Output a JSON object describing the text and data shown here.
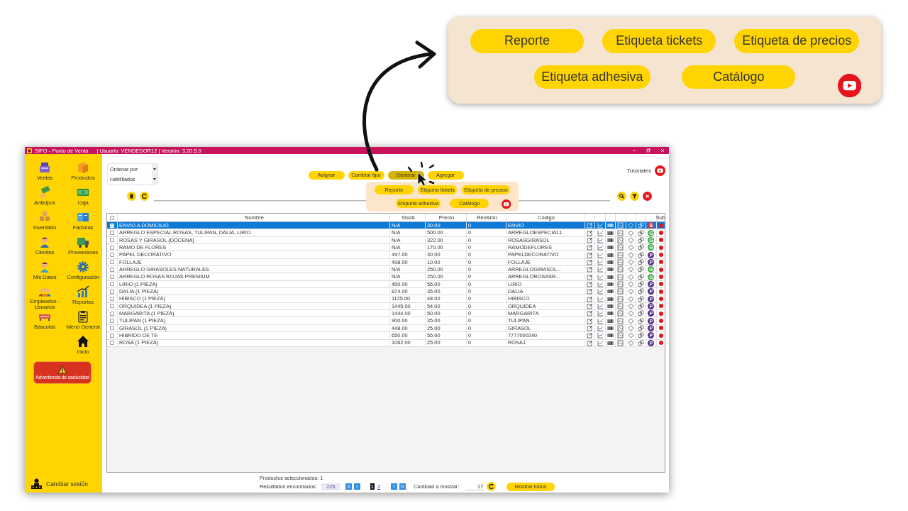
{
  "window": {
    "title": "SIFO - Punto de Venta",
    "user_info": "| Usuario: VENDEDOR12 | Versión: 3.20.5.0"
  },
  "sidebar": {
    "items": [
      {
        "label": "Ventas"
      },
      {
        "label": "Productos"
      },
      {
        "label": "Anticipos"
      },
      {
        "label": "Caja"
      },
      {
        "label": "Inventario"
      },
      {
        "label": "Facturas"
      },
      {
        "label": "Clientes"
      },
      {
        "label": "Proveedores"
      },
      {
        "label": "Mis Datos"
      },
      {
        "label": "Configuración"
      },
      {
        "label": "Empleados - Usuarios"
      },
      {
        "label": "Reportes"
      },
      {
        "label": "Básculas"
      },
      {
        "label": "Menú General"
      },
      {
        "label": "Inicio"
      }
    ],
    "alert_button": "Advertencia de caducidad",
    "session_button": "Cambiar sesión"
  },
  "filters": {
    "sort_label": "Ordenar por:",
    "status": "Habilitados"
  },
  "actions": [
    {
      "label": "Asignar",
      "selected": false
    },
    {
      "label": "Cambiar tipo",
      "selected": false
    },
    {
      "label": "Generar",
      "selected": true
    },
    {
      "label": "Agregar",
      "selected": false
    }
  ],
  "tutorials": "Tutoriales",
  "generate_menu": {
    "items": [
      "Reporte",
      "Etiqueta tickets",
      "Etiqueta de precios",
      "Etiqueta adhesiva",
      "Catálogo"
    ]
  },
  "callout": {
    "items": [
      "Reporte",
      "Etiqueta tickets",
      "Etiqueta de precios",
      "Etiqueta adhesiva",
      "Catálogo"
    ]
  },
  "table": {
    "select_all": {
      "checked": false
    },
    "columns": [
      "Nombre",
      "Stock",
      "Precio",
      "Revisión",
      "Código",
      "Sub"
    ],
    "rows": [
      {
        "name": "ENVIO A DOMICILIO",
        "stock": "N/A",
        "price": "30.00",
        "revision": "0",
        "code": "ENVIO",
        "type": "S",
        "color": "#d7343c",
        "selected": true,
        "checked": true
      },
      {
        "name": "ARREGLO ESPECIAL ROSAS, TULIPAN, DALIA, LIRIO",
        "stock": "N/A",
        "price": "500.00",
        "revision": "0",
        "code": "ARREGLOESPECIAL1",
        "type": "G",
        "color": "#3fae49",
        "selected": false,
        "checked": false
      },
      {
        "name": "ROSAS Y GIRASOL (DOCENA)",
        "stock": "N/A",
        "price": "322.00",
        "revision": "0",
        "code": "ROSASGIRASOL",
        "type": "G",
        "color": "#3fae49",
        "selected": false,
        "checked": false
      },
      {
        "name": "RAMO DE FLORES",
        "stock": "N/A",
        "price": "170.00",
        "revision": "0",
        "code": "RAMODEFLORES",
        "type": "G",
        "color": "#3fae49",
        "selected": false,
        "checked": false
      },
      {
        "name": "PAPEL DECORATIVO",
        "stock": "497.00",
        "price": "30.00",
        "revision": "0",
        "code": "PAPELDECORATIVO",
        "type": "P",
        "color": "#5a2d91",
        "selected": false,
        "checked": false
      },
      {
        "name": "FOLLAJE",
        "stock": "498.00",
        "price": "10.00",
        "revision": "0",
        "code": "FOLLAJE",
        "type": "P",
        "color": "#5a2d91",
        "selected": false,
        "checked": false
      },
      {
        "name": "ARREGLO GIRASOLES NATURALES",
        "stock": "N/A",
        "price": "250.00",
        "revision": "0",
        "code": "ARREGLOGIRASOL...",
        "type": "G",
        "color": "#3fae49",
        "selected": false,
        "checked": false
      },
      {
        "name": "ARREGLO ROSAS ROJAS PREMIUM",
        "stock": "N/A",
        "price": "250.00",
        "revision": "0",
        "code": "ARREGLOROSASR...",
        "type": "G",
        "color": "#3fae49",
        "selected": false,
        "checked": false
      },
      {
        "name": "LIRIO (1 PIEZA)",
        "stock": "450.00",
        "price": "55.00",
        "revision": "0",
        "code": "LIRIO",
        "type": "P",
        "color": "#5a2d91",
        "selected": false,
        "checked": false
      },
      {
        "name": "DALIA (1 PIEZA)",
        "stock": "874.00",
        "price": "35.00",
        "revision": "0",
        "code": "DALIA",
        "type": "P",
        "color": "#5a2d91",
        "selected": false,
        "checked": false
      },
      {
        "name": "HIBISCO (1 PIEZA)",
        "stock": "1125.00",
        "price": "48.00",
        "revision": "0",
        "code": "HIBISCO",
        "type": "P",
        "color": "#5a2d91",
        "selected": false,
        "checked": false
      },
      {
        "name": "ORQUIDEA (1 PIEZA)",
        "stock": "1445.00",
        "price": "54.00",
        "revision": "0",
        "code": "ORQUIDEA",
        "type": "P",
        "color": "#5a2d91",
        "selected": false,
        "checked": false
      },
      {
        "name": "MARGARITA (1 PIEZA)",
        "stock": "1444.00",
        "price": "50.00",
        "revision": "0",
        "code": "MARGARITA",
        "type": "P",
        "color": "#5a2d91",
        "selected": false,
        "checked": false
      },
      {
        "name": "TULIPAN (1 PIEZA)",
        "stock": "900.00",
        "price": "35.00",
        "revision": "0",
        "code": "TULIPAN",
        "type": "P",
        "color": "#5a2d91",
        "selected": false,
        "checked": false
      },
      {
        "name": "GIRASOL (1 PIEZA)",
        "stock": "448.00",
        "price": "25.00",
        "revision": "0",
        "code": "GIRASOL",
        "type": "P",
        "color": "#5a2d91",
        "selected": false,
        "checked": false
      },
      {
        "name": "HIBRIDO DE TE",
        "stock": "650.00",
        "price": "55.00",
        "revision": "0",
        "code": "7777000240",
        "type": "P",
        "color": "#5a2d91",
        "selected": false,
        "checked": false
      },
      {
        "name": "ROSA (1 PIEZA)",
        "stock": "1062.00",
        "price": "25.00",
        "revision": "0",
        "code": "ROSA1",
        "type": "P",
        "color": "#5a2d91",
        "selected": false,
        "checked": false
      }
    ]
  },
  "footer": {
    "selected_label": "Productos seleccionados: 1",
    "results_label": "Resultados encontrados:",
    "results_count": "225",
    "pages": [
      {
        "label": "1",
        "selected": true
      },
      {
        "label": "2",
        "selected": false
      }
    ],
    "quantity_label": "Cantidad a mostrar:",
    "quantity": "17",
    "show_all": "Mostrar todos"
  }
}
